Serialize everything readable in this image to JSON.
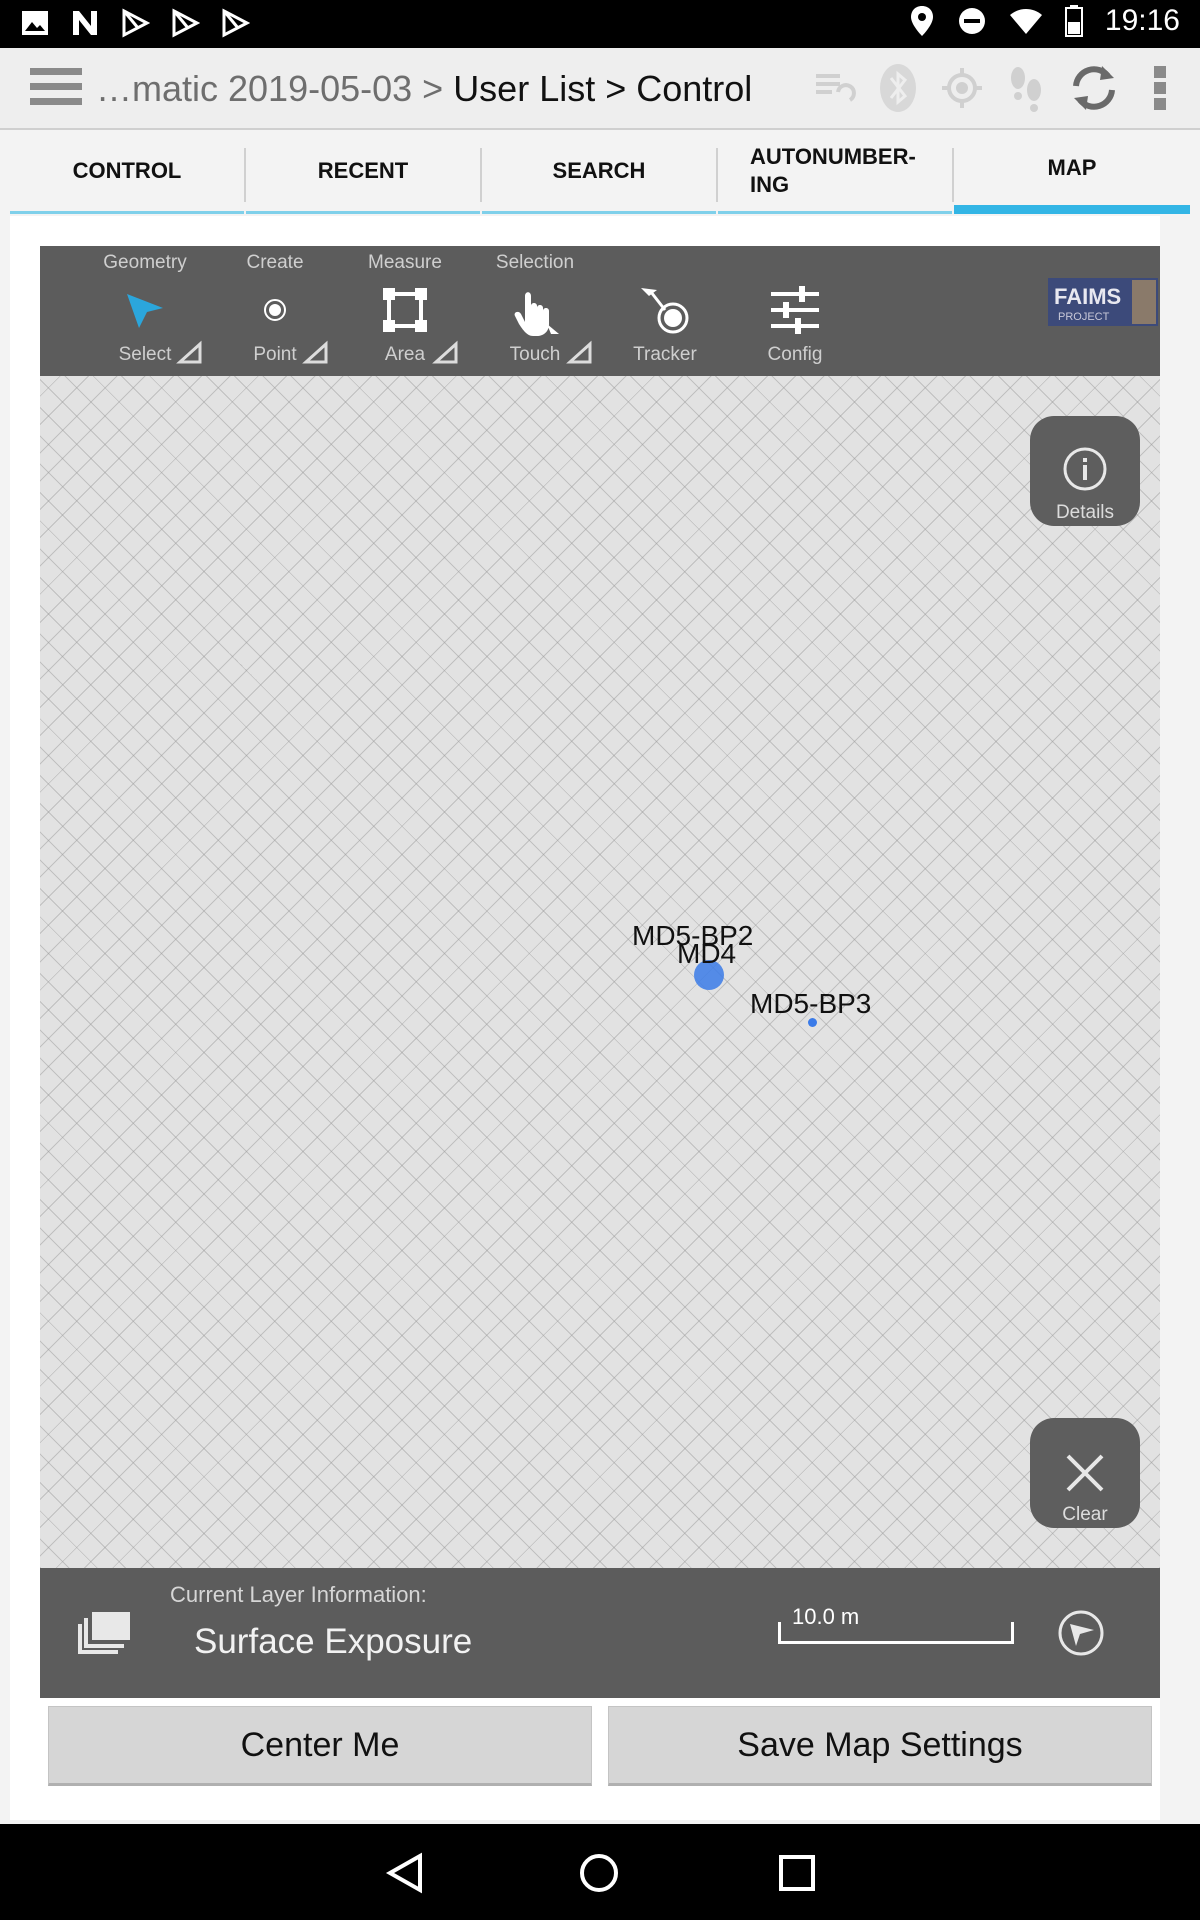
{
  "status_bar": {
    "time": "19:16",
    "left_icons": [
      "image-icon",
      "n-icon",
      "play-store-icon",
      "play-store-icon",
      "play-store-icon"
    ],
    "right_icons": [
      "location-icon",
      "do-not-disturb-icon",
      "wifi-icon",
      "battery-icon"
    ]
  },
  "action_bar": {
    "breadcrumb_dim": "…matic 2019-05-03 > ",
    "breadcrumb_main": "User List > Control",
    "icons": [
      "sync-status-icon",
      "bluetooth-icon",
      "gps-icon",
      "tracker-footsteps-icon",
      "refresh-icon",
      "overflow-menu-icon"
    ]
  },
  "tabs": [
    {
      "label": "CONTROL"
    },
    {
      "label": "RECENT"
    },
    {
      "label": "SEARCH"
    },
    {
      "label": "AUTONUMBER-\nING"
    },
    {
      "label": "MAP",
      "active": true
    }
  ],
  "toolbar": {
    "tools": [
      {
        "category": "Geometry",
        "label": "Select",
        "icon": "select-arrow-icon",
        "has_menu": true
      },
      {
        "category": "Create",
        "label": "Point",
        "icon": "point-icon",
        "has_menu": true
      },
      {
        "category": "Measure",
        "label": "Area",
        "icon": "area-icon",
        "has_menu": true
      },
      {
        "category": "Selection",
        "label": "Touch",
        "icon": "touch-icon",
        "has_menu": true
      },
      {
        "category": "",
        "label": "Tracker",
        "icon": "tracker-icon",
        "has_menu": false
      },
      {
        "category": "",
        "label": "Config",
        "icon": "config-sliders-icon",
        "has_menu": false
      }
    ],
    "logo_text": [
      "FAIMS",
      "PROJECT"
    ]
  },
  "map": {
    "details_label": "Details",
    "clear_label": "Clear",
    "markers": [
      {
        "label": "MD5-BP2"
      },
      {
        "label": "MD4"
      },
      {
        "label": "MD5-BP3"
      }
    ],
    "marker_color": "#3b7be8"
  },
  "layer_info": {
    "caption": "Current Layer Information:",
    "layer_name": "Surface Exposure",
    "scale_label": "10.0 m"
  },
  "buttons": {
    "center_me": "Center Me",
    "save_map_settings": "Save Map Settings"
  },
  "colors": {
    "accent": "#33b5e5",
    "toolbar_bg": "#5c5c5c"
  }
}
